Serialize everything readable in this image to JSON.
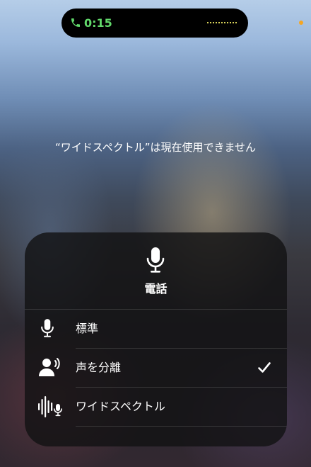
{
  "status": {
    "call_timer": "0:15",
    "call_color": "#62d96b",
    "icons": [
      "phone-icon",
      "waveform-icon",
      "mic-indicator-dot"
    ]
  },
  "message": "“ワイドスペクトル”は現在使用できません",
  "panel": {
    "header_icon": "microphone-icon",
    "title": "電話",
    "options": [
      {
        "label": "標準",
        "icon": "microphone-icon",
        "selected": false
      },
      {
        "label": "声を分離",
        "icon": "voice-isolation-icon",
        "selected": true
      },
      {
        "label": "ワイドスペクトル",
        "icon": "wide-spectrum-icon",
        "selected": false
      }
    ]
  }
}
